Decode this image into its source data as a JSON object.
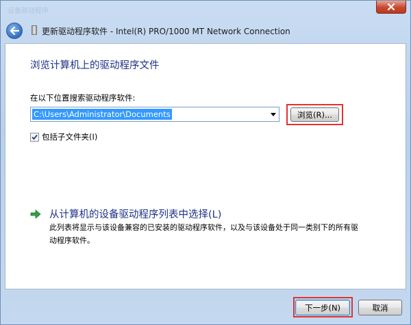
{
  "window": {
    "faded_title": "设备驱动程序",
    "close_icon": "close-icon"
  },
  "header": {
    "back_icon": "back-arrow-icon",
    "device_icon": "device-icon",
    "title": "更新驱动程序软件 - Intel(R) PRO/1000 MT Network Connection"
  },
  "main": {
    "page_title": "浏览计算机上的驱动程序文件",
    "search_label": "在以下位置搜索驱动程序软件:",
    "path_value": "C:\\Users\\Administrator\\Documents",
    "browse_label": "浏览(R)...",
    "include_subfolders": {
      "checked": true,
      "label": "包括子文件夹(I)"
    },
    "pick_option": {
      "icon": "green-arrow-icon",
      "title": "从计算机的设备驱动程序列表中选择(L)",
      "description": "此列表将显示与该设备兼容的已安装的驱动程序软件，以及与该设备处于同一类别下的所有驱动程序软件。"
    }
  },
  "footer": {
    "next_label": "下一步(N)",
    "cancel_label": "取消"
  },
  "colors": {
    "accent_text": "#1e3287",
    "selection": "#3399ff",
    "highlight_box": "#e23131",
    "arrow_green": "#2ea043"
  }
}
